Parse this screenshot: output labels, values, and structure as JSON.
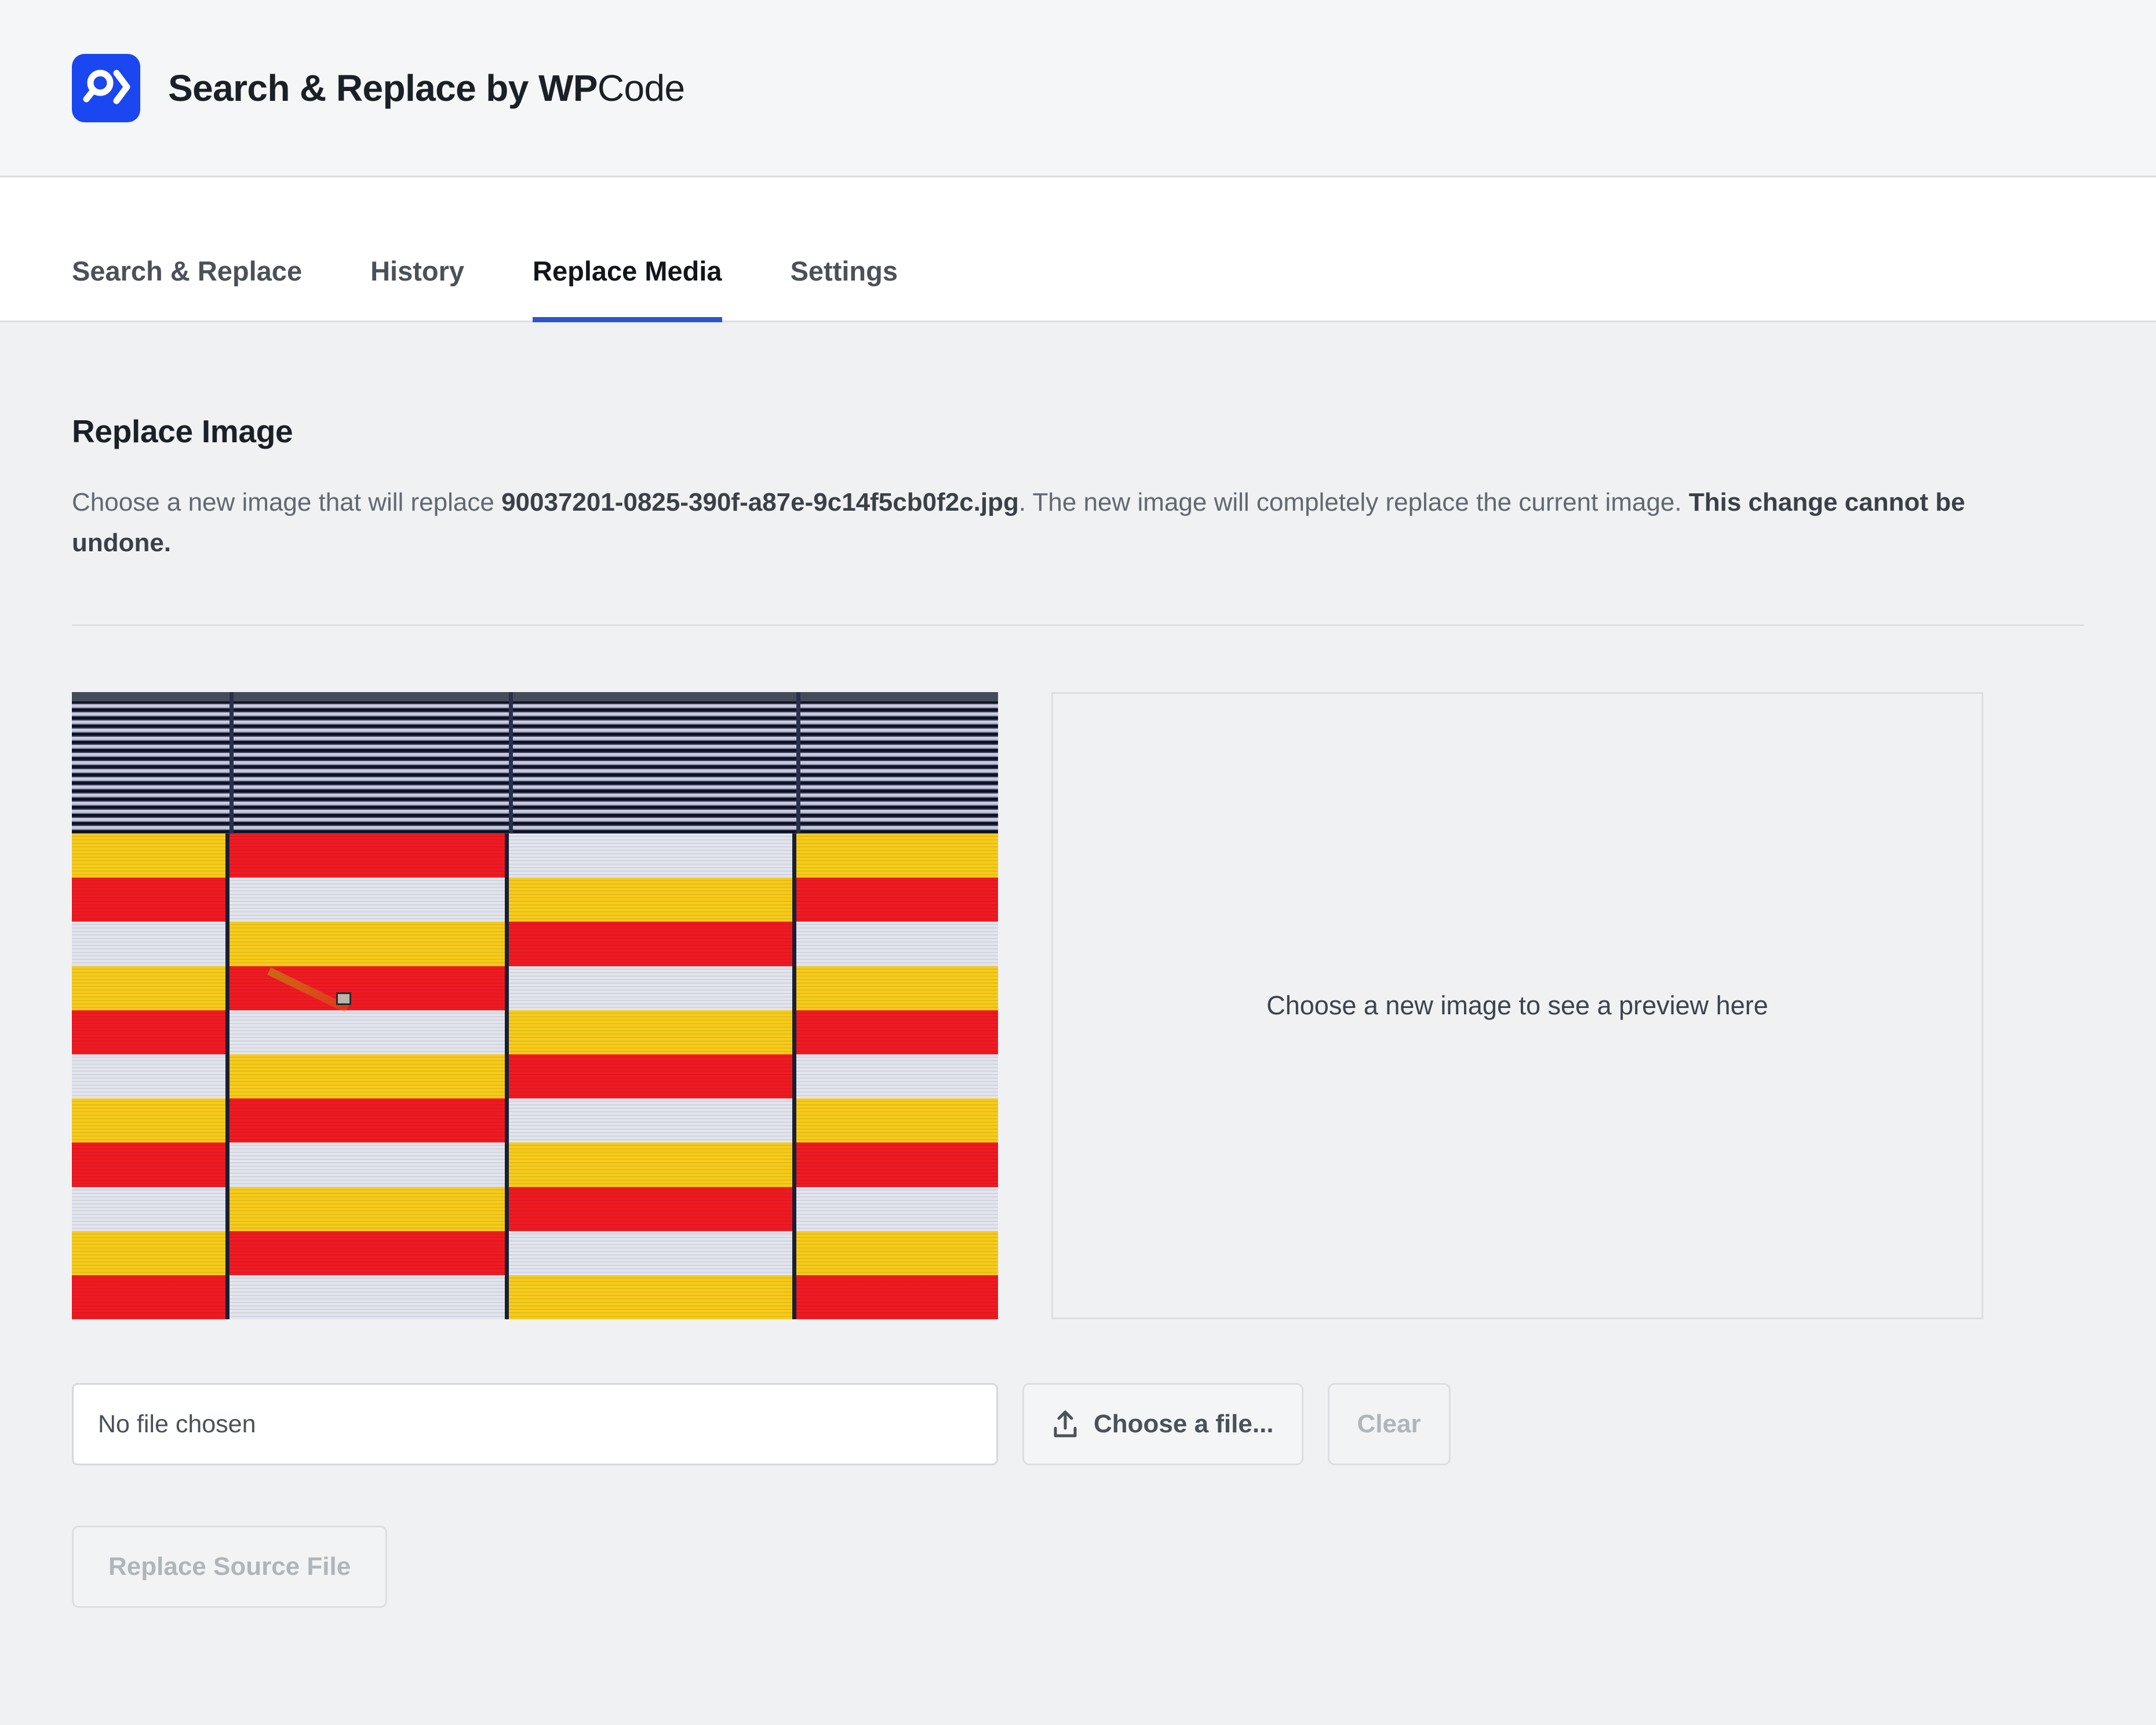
{
  "header": {
    "logo_icon": "search-replace-logo-icon",
    "title_prefix": "Search & Replace by ",
    "title_wp": "WP",
    "title_code": "Code",
    "brand_color": "#1b47f0"
  },
  "tabs": [
    {
      "label": "Search & Replace",
      "active": false
    },
    {
      "label": "History",
      "active": false
    },
    {
      "label": "Replace Media",
      "active": true
    },
    {
      "label": "Settings",
      "active": false
    }
  ],
  "active_tab_underline_color": "#2f55c9",
  "main": {
    "section_title": "Replace Image",
    "desc_part1": "Choose a new image that will replace ",
    "desc_filename": "90037201-0825-390f-a87e-9c14f5cb0f2c.jpg",
    "desc_part2": ". The new image will completely replace the current image. ",
    "desc_warning": "This change cannot be undone.",
    "preview_placeholder": "Choose a new image to see a preview here"
  },
  "file_row": {
    "file_value": "No file chosen",
    "choose_label": "Choose a file...",
    "choose_icon": "upload-icon",
    "clear_label": "Clear"
  },
  "replace_row": {
    "replace_label": "Replace Source File"
  },
  "current_image": {
    "colors": {
      "red": "#f01a22",
      "yellow": "#f7cb1a",
      "white": "#e2e5ee",
      "mullion": "#191f33",
      "louver_dark": "#0d1327",
      "louver_light": "#c9c8de"
    },
    "panels": [
      {
        "width_pct": 17.0,
        "bands": [
          "yellow",
          "red",
          "white",
          "yellow",
          "red",
          "white",
          "yellow",
          "red",
          "white",
          "yellow",
          "red"
        ]
      },
      {
        "width_pct": 30.2,
        "bands": [
          "red",
          "white",
          "yellow",
          "red",
          "white",
          "yellow",
          "red",
          "white",
          "yellow",
          "red",
          "white"
        ]
      },
      {
        "width_pct": 31.0,
        "bands": [
          "white",
          "yellow",
          "red",
          "white",
          "yellow",
          "red",
          "white",
          "yellow",
          "red",
          "white",
          "yellow"
        ]
      },
      {
        "width_pct": 21.8,
        "bands": [
          "yellow",
          "red",
          "white",
          "yellow",
          "red",
          "white",
          "yellow",
          "red",
          "white",
          "yellow",
          "red"
        ]
      }
    ]
  }
}
